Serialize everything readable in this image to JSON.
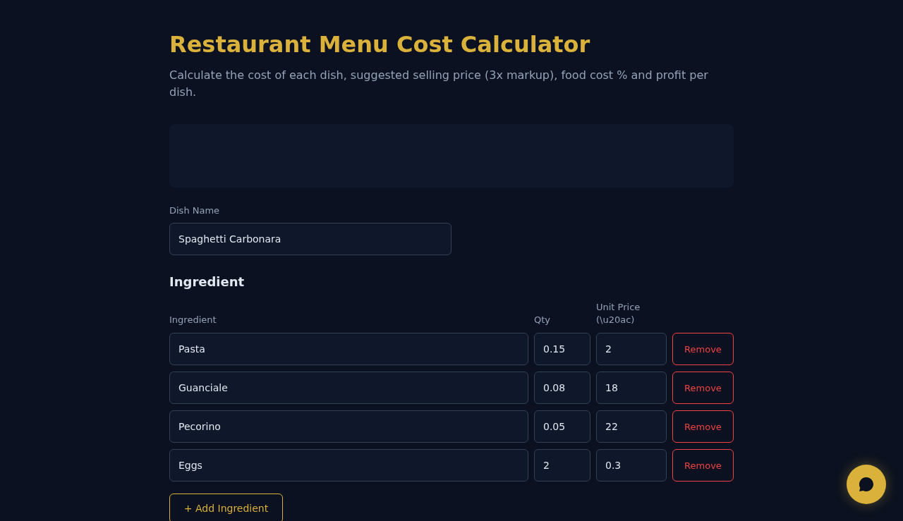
{
  "header": {
    "title": "Restaurant Menu Cost Calculator",
    "subtitle": "Calculate the cost of each dish, suggested selling price (3x markup), food cost % and profit per dish."
  },
  "dish": {
    "label": "Dish Name",
    "value": "Spaghetti Carbonara"
  },
  "ingredients": {
    "heading": "Ingredient",
    "columns": [
      "Ingredient",
      "Qty",
      "Unit Price (\\u20ac)"
    ],
    "rows": [
      {
        "name": "Pasta",
        "qty": "0.15",
        "unit_price": "2",
        "action": "Remove"
      },
      {
        "name": "Guanciale",
        "qty": "0.08",
        "unit_price": "18",
        "action": "Remove"
      },
      {
        "name": "Pecorino",
        "qty": "0.05",
        "unit_price": "22",
        "action": "Remove"
      },
      {
        "name": "Eggs",
        "qty": "2",
        "unit_price": "0.3",
        "action": "Remove"
      }
    ],
    "add_button": "+ Add Ingredient"
  }
}
